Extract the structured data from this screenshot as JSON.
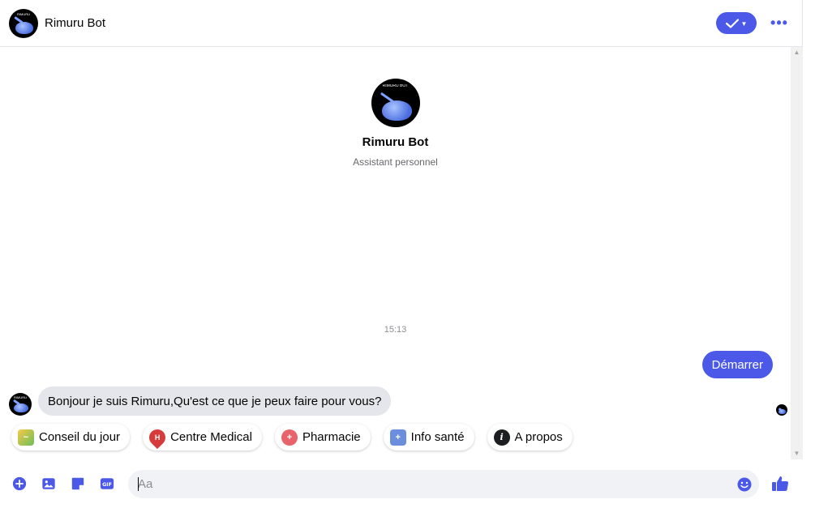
{
  "header": {
    "title": "Rimuru Bot",
    "check_icon": "check-icon",
    "more_icon": "more-horizontal-icon",
    "accent": "#4b58e8"
  },
  "avatar": {
    "badge_text": "RIMURU BOT"
  },
  "profile": {
    "name": "Rimuru Bot",
    "subtitle": "Assistant personnel"
  },
  "conversation": {
    "timestamp": "15:13",
    "outgoing": "Démarrer",
    "incoming": "Bonjour je suis Rimuru,Qu'est ce que je peux faire pour vous?"
  },
  "quick_replies": [
    {
      "label": "Conseil du jour",
      "icon": "leaf-icon"
    },
    {
      "label": "Centre Medical",
      "icon": "map-pin-hospital-icon"
    },
    {
      "label": "Pharmacie",
      "icon": "pharmacy-icon"
    },
    {
      "label": "Info santé",
      "icon": "health-info-icon"
    },
    {
      "label": "A propos",
      "icon": "info-icon"
    }
  ],
  "composer": {
    "placeholder": "Aa",
    "icons": [
      "add-icon",
      "image-icon",
      "sticker-icon",
      "gif-icon",
      "emoji-icon",
      "thumbs-up-icon"
    ]
  },
  "colors": {
    "brand": "#4b58e8",
    "bubble_incoming": "#e4e6eb",
    "muted_text": "#65676b"
  }
}
